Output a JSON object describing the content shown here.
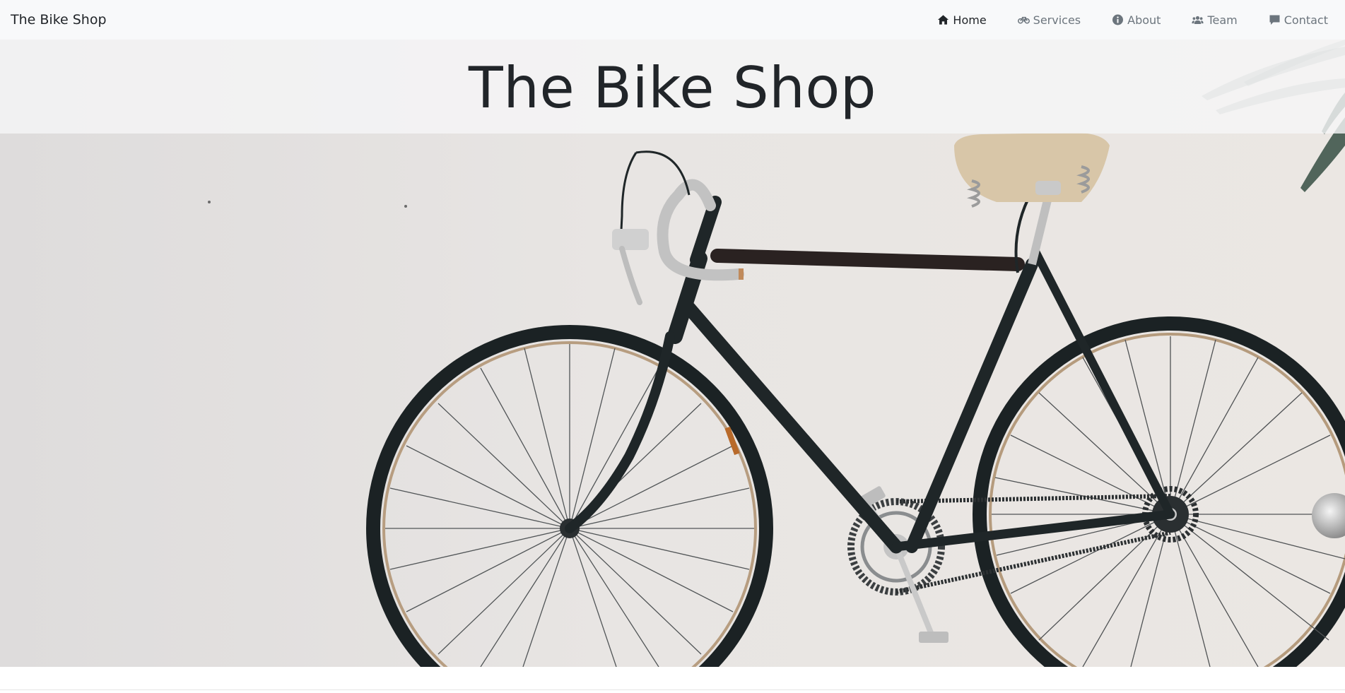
{
  "navbar": {
    "brand": "The Bike Shop",
    "items": [
      {
        "label": "Home",
        "icon": "home-icon",
        "active": true
      },
      {
        "label": "Services",
        "icon": "bicycle-icon",
        "active": false
      },
      {
        "label": "About",
        "icon": "info-circle-icon",
        "active": false
      },
      {
        "label": "Team",
        "icon": "users-icon",
        "active": false
      },
      {
        "label": "Contact",
        "icon": "comment-icon",
        "active": false
      }
    ]
  },
  "hero": {
    "title": "The Bike Shop",
    "image": "bicycle-on-wall-photo"
  },
  "colors": {
    "navbar_bg": "#f8f9fa",
    "text_dark": "#212529",
    "text_muted": "#6c757d",
    "wall": "#e4e2e0",
    "frame": "#1f2628"
  }
}
